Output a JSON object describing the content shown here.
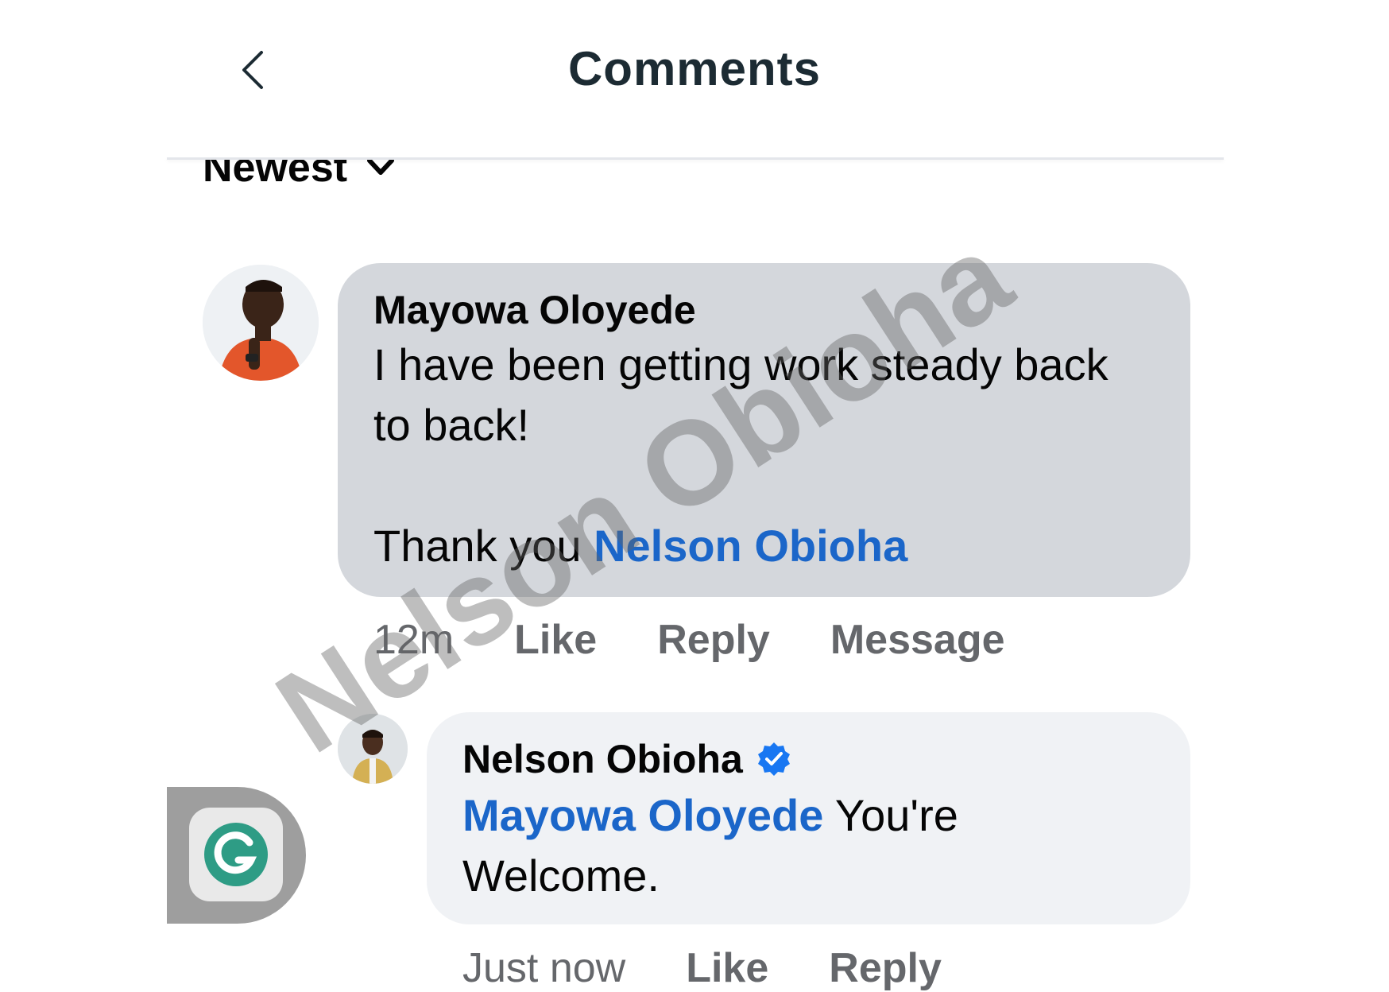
{
  "header": {
    "title": "Comments",
    "back_icon": "chevron-left-icon"
  },
  "sort": {
    "label": "Newest",
    "icon": "chevron-down-icon"
  },
  "comments": [
    {
      "author": "Mayowa Oloyede",
      "text_line1": "I have been getting work steady back",
      "text_line2": "to back!",
      "text_thanks": "Thank you",
      "mention": "Nelson Obioha",
      "time": "12m",
      "actions": {
        "like": "Like",
        "reply": "Reply",
        "message": "Message"
      },
      "bubble_color": "#d4d7dc"
    },
    {
      "author": "Nelson Obioha",
      "verified": true,
      "verified_icon": "verified-badge-icon",
      "mention": "Mayowa Oloyede",
      "text_after_mention": " You're",
      "text_line2": "Welcome.",
      "time": "Just now",
      "actions": {
        "like": "Like",
        "reply": "Reply"
      },
      "bubble_color": "#f0f2f5"
    }
  ],
  "watermark": "Nelson Obioha",
  "colors": {
    "mention": "#1b66c9",
    "verified": "#1877f2",
    "secondary_text": "#65676b",
    "title": "#1c2b33"
  },
  "floating_button": {
    "icon": "grammarly-icon"
  }
}
